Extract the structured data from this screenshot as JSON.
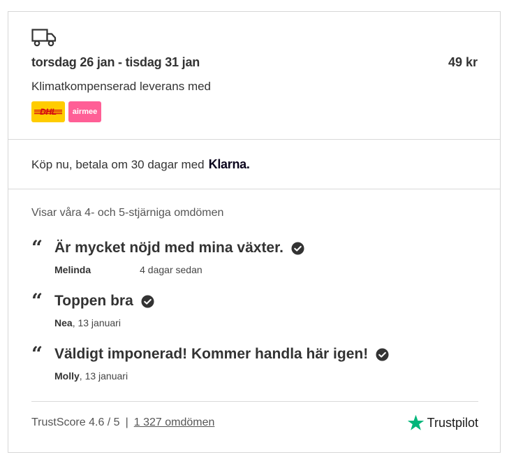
{
  "delivery": {
    "icon": "truck-icon",
    "dates": "torsdag 26 jan - tisdag 31 jan",
    "price": "49 kr",
    "climate_text": "Klimatkompenserad leverans med",
    "carriers": [
      {
        "name": "DHL",
        "color": "#ffcc00",
        "text_color": "#d40511"
      },
      {
        "name": "airmee",
        "color": "#ff5f96",
        "text_color": "#ffffff"
      }
    ]
  },
  "payment": {
    "text": "Köp nu, betala om 30 dagar med",
    "provider": "Klarna."
  },
  "reviews": {
    "intro": "Visar våra 4- och 5-stjärniga omdömen",
    "items": [
      {
        "title": "Är mycket nöjd med mina växter.",
        "author": "Melinda",
        "date": "4 dagar sedan"
      },
      {
        "title": "Toppen bra",
        "author": "Nea",
        "date": "13 januari"
      },
      {
        "title": "Väldigt imponerad! Kommer handla här igen!",
        "author": "Molly",
        "date": "13 januari"
      }
    ],
    "trustscore_label": "TrustScore 4.6 / 5",
    "separator": "|",
    "count_link": "1 327 omdömen",
    "trustpilot_label": "Trustpilot",
    "trustpilot_color": "#00b67a"
  }
}
